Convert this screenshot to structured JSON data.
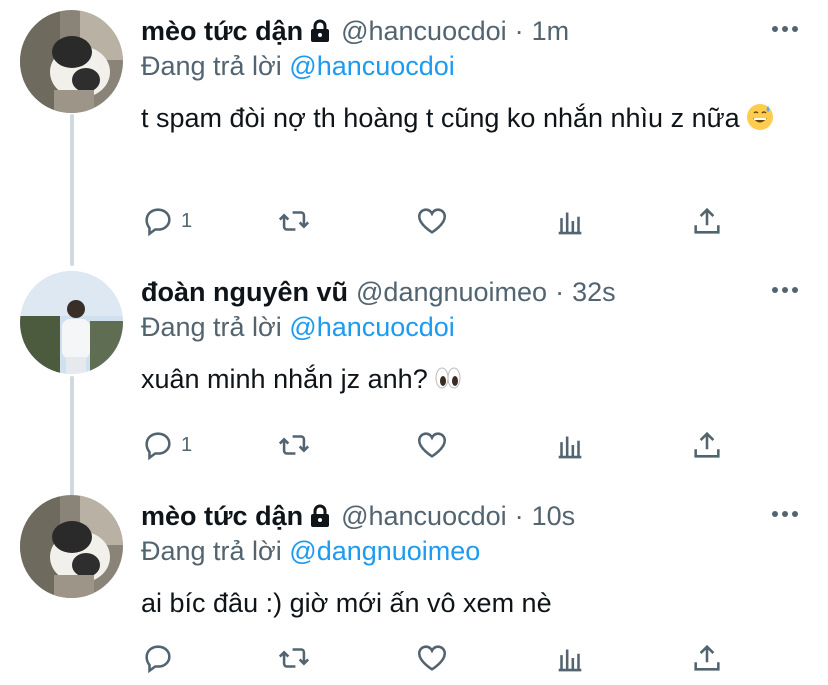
{
  "tweets": [
    {
      "name": "mèo tức dận",
      "handle": "@hancuocdoi",
      "dot": "·",
      "time": "1m",
      "replying_prefix": "Đang trả lời",
      "replying_to": "@hancuocdoi",
      "text": "t spam đòi nợ th hoàng t cũng ko nhắn nhìu z nữa",
      "emoji": "grinning-sweat-emoji",
      "reply_count": "1",
      "locked": true
    },
    {
      "name": "đoàn nguyên vũ",
      "handle": "@dangnuoimeo",
      "dot": "·",
      "time": "32s",
      "replying_prefix": "Đang trả lời",
      "replying_to": "@hancuocdoi",
      "text": "xuân minh nhắn jz anh?",
      "emoji": "eyes-emoji",
      "reply_count": "1",
      "locked": false
    },
    {
      "name": "mèo tức dận",
      "handle": "@hancuocdoi",
      "dot": "·",
      "time": "10s",
      "replying_prefix": "Đang trả lời",
      "replying_to": "@dangnuoimeo",
      "text": "ai bíc đâu :) giờ mới ấn vô xem nè",
      "emoji": "",
      "reply_count": "",
      "locked": true
    }
  ],
  "colors": {
    "link": "#1d9bf0",
    "secondary": "#536471",
    "thread_line": "#cfd9de"
  },
  "icons": [
    "reply-icon",
    "retweet-icon",
    "like-icon",
    "analytics-icon",
    "share-icon",
    "more-icon",
    "lock-icon"
  ]
}
